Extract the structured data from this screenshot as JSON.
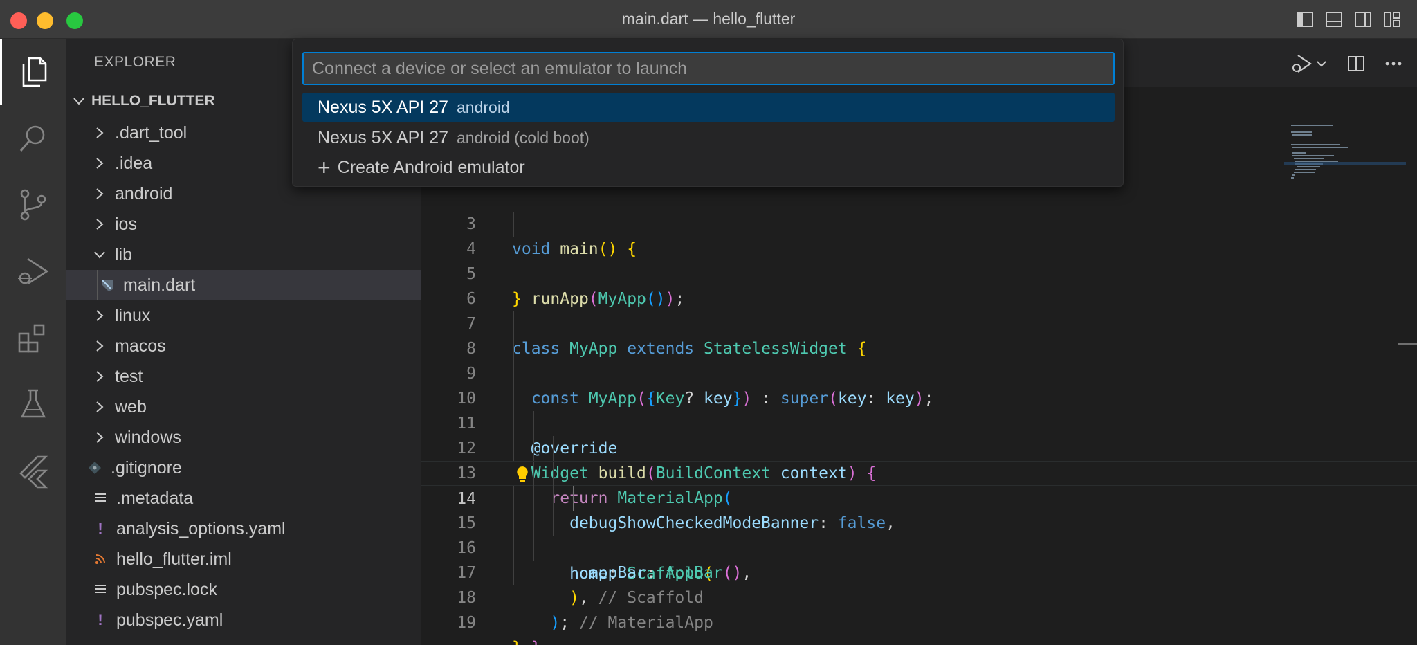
{
  "window": {
    "title": "main.dart — hello_flutter"
  },
  "explorer": {
    "header": "EXPLORER",
    "root": "HELLO_FLUTTER",
    "items": [
      {
        "label": ".dart_tool",
        "type": "folder",
        "expanded": false
      },
      {
        "label": ".idea",
        "type": "folder",
        "expanded": false
      },
      {
        "label": "android",
        "type": "folder",
        "expanded": false
      },
      {
        "label": "ios",
        "type": "folder",
        "expanded": false
      },
      {
        "label": "lib",
        "type": "folder",
        "expanded": true
      },
      {
        "label": "main.dart",
        "type": "dart-file",
        "selected": true
      },
      {
        "label": "linux",
        "type": "folder",
        "expanded": false
      },
      {
        "label": "macos",
        "type": "folder",
        "expanded": false
      },
      {
        "label": "test",
        "type": "folder",
        "expanded": false
      },
      {
        "label": "web",
        "type": "folder",
        "expanded": false
      },
      {
        "label": "windows",
        "type": "folder",
        "expanded": false
      },
      {
        "label": ".gitignore",
        "type": "git-file"
      },
      {
        "label": ".metadata",
        "type": "text-file"
      },
      {
        "label": "analysis_options.yaml",
        "type": "yaml-file"
      },
      {
        "label": "hello_flutter.iml",
        "type": "feed-file"
      },
      {
        "label": "pubspec.lock",
        "type": "text-file"
      },
      {
        "label": "pubspec.yaml",
        "type": "yaml-file"
      }
    ]
  },
  "quickpick": {
    "placeholder": "Connect a device or select an emulator to launch",
    "items": [
      {
        "label": "Nexus 5X API 27",
        "description": "android",
        "active": true
      },
      {
        "label": "Nexus 5X API 27",
        "description": "android (cold boot)",
        "active": false
      },
      {
        "label": "Create Android emulator",
        "description": "",
        "active": false
      }
    ]
  },
  "editor": {
    "current_line": "14",
    "line_numbers": [
      "3",
      "4",
      "5",
      "6",
      "7",
      "8",
      "9",
      "10",
      "11",
      "12",
      "13",
      "14",
      "15",
      "16",
      "17",
      "18",
      "19"
    ],
    "tokens": {
      "void": "void",
      "main": "main",
      "runApp": "runApp",
      "MyApp": "MyApp",
      "class": "class",
      "extends": "extends",
      "StatelessWidget": "StatelessWidget",
      "const": "const",
      "Key": "Key",
      "key": "key",
      "super": "super",
      "override": "@override",
      "Widget": "Widget",
      "build": "build",
      "BuildContext": "BuildContext",
      "context": "context",
      "return": "return",
      "MaterialApp": "MaterialApp",
      "debugBanner": "debugShowCheckedModeBanner",
      "false": "false",
      "home": "home",
      "Scaffold": "Scaffold",
      "appBar": "appBar",
      "AppBar": "AppBar",
      "cmt_scaffold": "// Scaffold",
      "cmt_material": "// MaterialApp"
    }
  },
  "colors": {
    "accent": "#007fd4",
    "selection": "#04395e"
  }
}
